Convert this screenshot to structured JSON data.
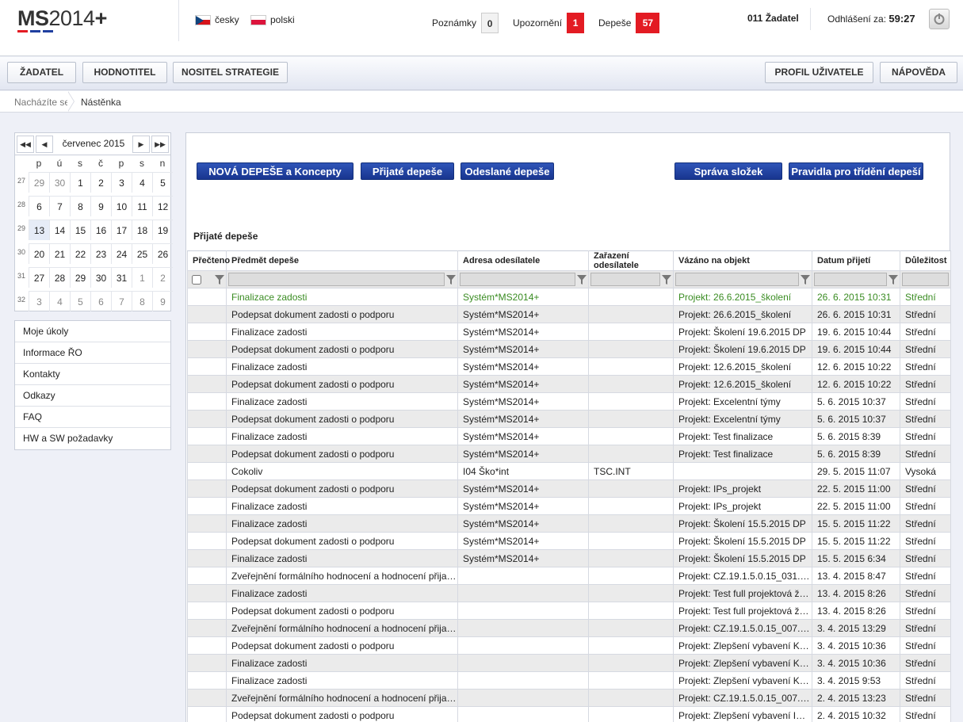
{
  "header": {
    "logo_main": "MS",
    "logo_thin": "2014",
    "logo_plus": "+",
    "languages": [
      "česky",
      "polski"
    ],
    "notes_label": "Poznámky",
    "notes_count": "0",
    "warnings_label": "Upozornění",
    "warnings_count": "1",
    "dispatches_label": "Depeše",
    "dispatches_count": "57",
    "user": "011 Žadatel",
    "logout_label": "Odhlášení za:",
    "logout_time": "59:27"
  },
  "topnav": {
    "left": [
      "ŽADATEL",
      "HODNOTITEL",
      "NOSITEL STRATEGIE"
    ],
    "right": [
      "PROFIL UŽIVATELE",
      "NÁPOVĚDA"
    ]
  },
  "breadcrumb": {
    "label": "Nacházíte se:",
    "current": "Nástěnka"
  },
  "calendar": {
    "title": "červenec 2015",
    "nav": [
      "◀◀",
      "◀",
      "▶",
      "▶▶"
    ],
    "dow": [
      "p",
      "ú",
      "s",
      "č",
      "p",
      "s",
      "n"
    ],
    "weeks": [
      {
        "n": "27",
        "days": [
          "29",
          "30",
          "1",
          "2",
          "3",
          "4",
          "5"
        ]
      },
      {
        "n": "28",
        "days": [
          "6",
          "7",
          "8",
          "9",
          "10",
          "11",
          "12"
        ]
      },
      {
        "n": "29",
        "days": [
          "13",
          "14",
          "15",
          "16",
          "17",
          "18",
          "19"
        ]
      },
      {
        "n": "30",
        "days": [
          "20",
          "21",
          "22",
          "23",
          "24",
          "25",
          "26"
        ]
      },
      {
        "n": "31",
        "days": [
          "27",
          "28",
          "29",
          "30",
          "31",
          "1",
          "2"
        ]
      },
      {
        "n": "32",
        "days": [
          "3",
          "4",
          "5",
          "6",
          "7",
          "8",
          "9"
        ]
      }
    ]
  },
  "sidemenu": [
    "Moje úkoly",
    "Informace ŘO",
    "Kontakty",
    "Odkazy",
    "FAQ",
    "HW a SW požadavky"
  ],
  "main": {
    "buttons_left": [
      "NOVÁ DEPEŠE a Koncepty",
      "Přijaté depeše",
      "Odeslané depeše"
    ],
    "buttons_right": [
      "Správa složek",
      "Pravidla pro třídění depeší"
    ],
    "title": "Přijaté depeše",
    "columns": [
      "Přečteno",
      "Předmět depeše",
      "Adresa odesílatele",
      "Zařazení odesílatele",
      "Vázáno na objekt",
      "Datum přijetí",
      "Důležitost"
    ],
    "rows": [
      [
        "",
        "Finalizace zadosti",
        "Systém*MS2014+",
        "",
        "Projekt: 26.6.2015_školení",
        "26. 6. 2015 10:31",
        "Střední"
      ],
      [
        "",
        "Podepsat dokument zadosti o podporu",
        "Systém*MS2014+",
        "",
        "Projekt: 26.6.2015_školení",
        "26. 6. 2015 10:31",
        "Střední"
      ],
      [
        "",
        "Finalizace zadosti",
        "Systém*MS2014+",
        "",
        "Projekt: Školení 19.6.2015 DP",
        "19. 6. 2015 10:44",
        "Střední"
      ],
      [
        "",
        "Podepsat dokument zadosti o podporu",
        "Systém*MS2014+",
        "",
        "Projekt: Školení 19.6.2015 DP",
        "19. 6. 2015 10:44",
        "Střední"
      ],
      [
        "",
        "Finalizace zadosti",
        "Systém*MS2014+",
        "",
        "Projekt: 12.6.2015_školení",
        "12. 6. 2015 10:22",
        "Střední"
      ],
      [
        "",
        "Podepsat dokument zadosti o podporu",
        "Systém*MS2014+",
        "",
        "Projekt: 12.6.2015_školení",
        "12. 6. 2015 10:22",
        "Střední"
      ],
      [
        "",
        "Finalizace zadosti",
        "Systém*MS2014+",
        "",
        "Projekt: Excelentní týmy",
        "5. 6. 2015 10:37",
        "Střední"
      ],
      [
        "",
        "Podepsat dokument zadosti o podporu",
        "Systém*MS2014+",
        "",
        "Projekt: Excelentní týmy",
        "5. 6. 2015 10:37",
        "Střední"
      ],
      [
        "",
        "Finalizace zadosti",
        "Systém*MS2014+",
        "",
        "Projekt: Test finalizace",
        "5. 6. 2015 8:39",
        "Střední"
      ],
      [
        "",
        "Podepsat dokument zadosti o podporu",
        "Systém*MS2014+",
        "",
        "Projekt: Test finalizace",
        "5. 6. 2015 8:39",
        "Střední"
      ],
      [
        "",
        "Cokoliv",
        "I04 Ško*int",
        "TSC.INT",
        "",
        "29. 5. 2015 11:07",
        "Vysoká"
      ],
      [
        "",
        "Podepsat dokument zadosti o podporu",
        "Systém*MS2014+",
        "",
        "Projekt: IPs_projekt",
        "22. 5. 2015 11:00",
        "Střední"
      ],
      [
        "",
        "Finalizace zadosti",
        "Systém*MS2014+",
        "",
        "Projekt: IPs_projekt",
        "22. 5. 2015 11:00",
        "Střední"
      ],
      [
        "",
        "Finalizace zadosti",
        "Systém*MS2014+",
        "",
        "Projekt: Školení 15.5.2015 DP",
        "15. 5. 2015 11:22",
        "Střední"
      ],
      [
        "",
        "Podepsat dokument zadosti o podporu",
        "Systém*MS2014+",
        "",
        "Projekt: Školení 15.5.2015 DP",
        "15. 5. 2015 11:22",
        "Střední"
      ],
      [
        "",
        "Finalizace zadosti",
        "Systém*MS2014+",
        "",
        "Projekt: Školení 15.5.2015 DP",
        "15. 5. 2015 6:34",
        "Střední"
      ],
      [
        "",
        "Zveřejnění formálního hodnocení a hodnocení přijateln...",
        "",
        "",
        "Projekt: CZ.19.1.5.0.15_031.0...",
        "13. 4. 2015 8:47",
        "Střední"
      ],
      [
        "",
        "Finalizace zadosti",
        "",
        "",
        "Projekt: Test full projektová žá...",
        "13. 4. 2015 8:26",
        "Střední"
      ],
      [
        "",
        "Podepsat dokument zadosti o podporu",
        "",
        "",
        "Projekt: Test full projektová žá...",
        "13. 4. 2015 8:26",
        "Střední"
      ],
      [
        "",
        "Zveřejnění formálního hodnocení a hodnocení přijateln...",
        "",
        "",
        "Projekt: CZ.19.1.5.0.15_007.0...",
        "3. 4. 2015 13:29",
        "Střední"
      ],
      [
        "",
        "Podepsat dokument zadosti o podporu",
        "",
        "",
        "Projekt: Zlepšení vybavení KA...",
        "3. 4. 2015 10:36",
        "Střední"
      ],
      [
        "",
        "Finalizace zadosti",
        "",
        "",
        "Projekt: Zlepšení vybavení KA...",
        "3. 4. 2015 10:36",
        "Střední"
      ],
      [
        "",
        "Finalizace zadosti",
        "",
        "",
        "Projekt: Zlepšení vybavení KA...",
        "3. 4. 2015 9:53",
        "Střední"
      ],
      [
        "",
        "Zveřejnění formálního hodnocení a hodnocení přijateln...",
        "",
        "",
        "Projekt: CZ.19.1.5.0.15_007.0...",
        "2. 4. 2015 13:23",
        "Střední"
      ],
      [
        "",
        "Podepsat dokument zadosti o podporu",
        "",
        "",
        "Projekt: Zlepšení vybavení IPs ...",
        "2. 4. 2015 10:32",
        "Střední"
      ]
    ]
  },
  "colors": {
    "accent_blue": "#1f3f9f",
    "badge_red": "#e31b23",
    "unread_green": "#3a8c22"
  }
}
